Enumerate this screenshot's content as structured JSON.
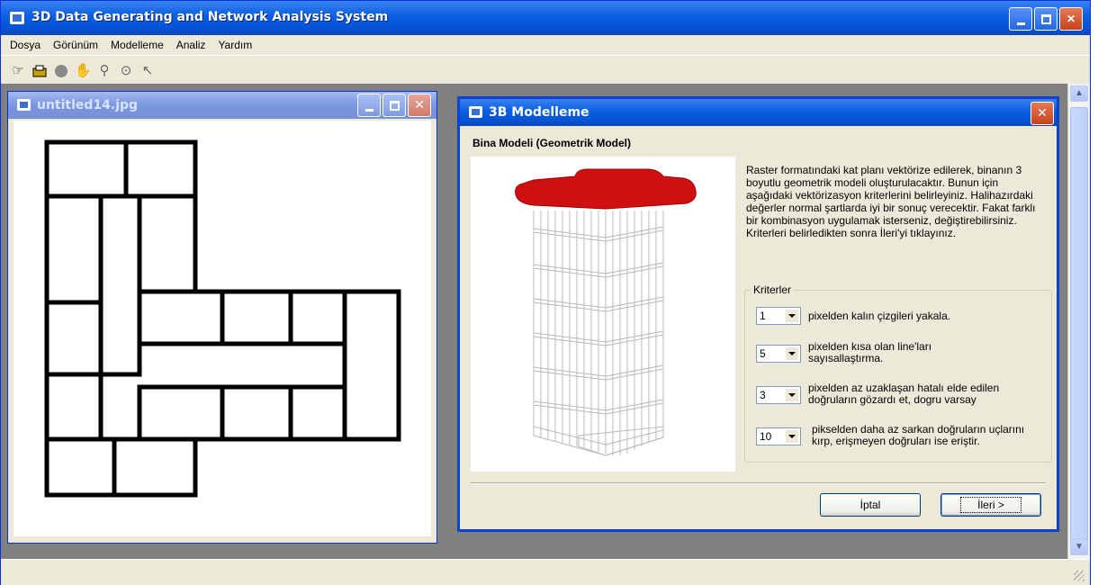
{
  "app": {
    "title": "3D Data Generating and Network Analysis System"
  },
  "menu": [
    "Dosya",
    "Görünüm",
    "Modelleme",
    "Analiz",
    "Yardım"
  ],
  "toolbar": {
    "icons": [
      "hand-pointer-icon",
      "save-icon",
      "circle-icon",
      "pan-icon",
      "zoom-icon",
      "target-icon",
      "select-icon"
    ]
  },
  "child_window": {
    "title": "untitled14.jpg"
  },
  "dialog": {
    "title": "3B Modelleme",
    "section_title": "Bina Modeli (Geometrik Model)",
    "description": "Raster formatındaki kat planı vektörize edilerek, binanın 3 boyutlu geometrik modeli oluşturulacaktır. Bunun için aşağıdaki vektörizasyon kriterlerini belirleyiniz. Halihazırdaki değerler normal şartlarda iyi bir sonuç verecektir. Fakat farklı bir kombinasyon uygulamak isterseniz, değiştirebilirsiniz. Kriterleri belirledikten sonra İleri'yi tıklayınız.",
    "criteria_legend": "Kriterler",
    "criteria": [
      {
        "value": "1",
        "label": "pixelden kalın çizgileri yakala."
      },
      {
        "value": "5",
        "label": "pixelden kısa olan line'ları sayısallaştırma."
      },
      {
        "value": "3",
        "label": "pixelden az uzaklaşan hatalı elde edilen doğruların  gözardı et, dogru varsay"
      },
      {
        "value": "10",
        "label": "pikselden daha az sarkan doğruların uçlarını kırp, erişmeyen doğruları ise eriştir."
      }
    ],
    "cancel_label": "İptal",
    "next_label": "İleri >"
  },
  "colors": {
    "titlebar": "#0553d6",
    "roof": "#d01010",
    "window_bg": "#ece9d8",
    "mdi_bg": "#808080"
  }
}
